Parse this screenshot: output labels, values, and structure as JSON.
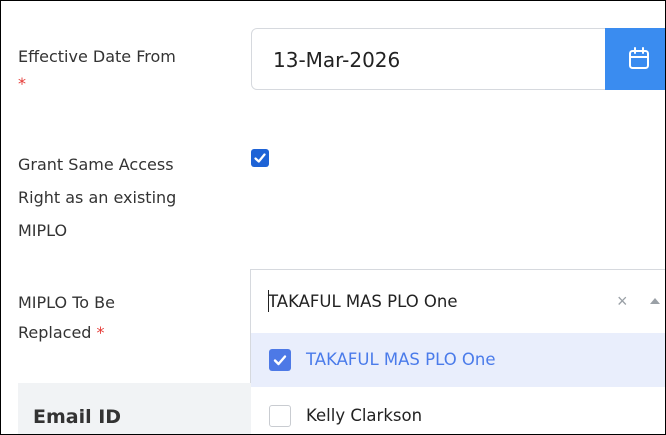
{
  "form": {
    "effective_date_label": "Effective Date From",
    "effective_date_required": "*",
    "effective_date_value": "13-Mar-2026",
    "calendar_icon": "calendar-icon",
    "grant_label_line1": "Grant Same Access",
    "grant_label_line2": "Right as an existing",
    "grant_label_line3": "MIPLO",
    "grant_checked": true,
    "replace_label_line1": "MIPLO To Be",
    "replace_label_line2": "Replaced",
    "replace_required": "*",
    "replace_value": "TAKAFUL MAS PLO One",
    "clear_glyph": "×",
    "options": [
      {
        "label": "TAKAFUL MAS PLO One",
        "checked": true
      },
      {
        "label": "Kelly Clarkson",
        "checked": false
      }
    ],
    "email_header": "Email ID"
  },
  "colors": {
    "accent": "#3a8cf0",
    "checkbox": "#1e63d6",
    "selected_option_bg": "#e9eefc",
    "selected_option_text": "#4a7bea",
    "required": "#e53935"
  }
}
